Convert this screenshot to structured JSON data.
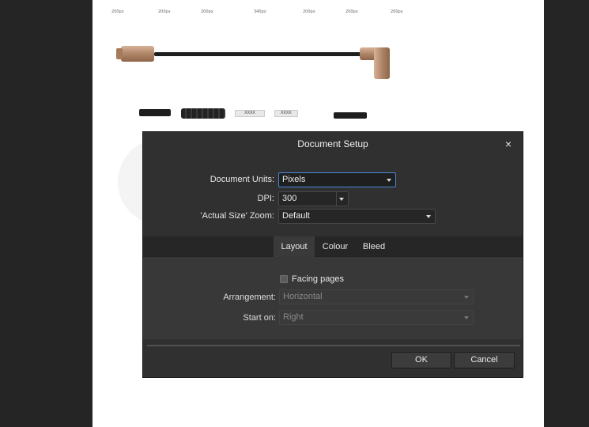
{
  "canvas": {
    "ruler_labels": [
      "200px",
      "200px",
      "200px",
      "340px",
      "200px",
      "200px",
      "200px"
    ],
    "part_labels": [
      "XXXX",
      "XXXX"
    ]
  },
  "dialog": {
    "title": "Document Setup",
    "close_icon": "×",
    "document_units": {
      "label": "Document Units:",
      "value": "Pixels"
    },
    "dpi": {
      "label": "DPI:",
      "value": "300"
    },
    "zoom": {
      "label": "'Actual Size' Zoom:",
      "value": "Default"
    },
    "tabs": [
      {
        "label": "Layout",
        "active": true
      },
      {
        "label": "Colour",
        "active": false
      },
      {
        "label": "Bleed",
        "active": false
      }
    ],
    "facing_pages": {
      "label": "Facing pages",
      "checked": false
    },
    "arrangement": {
      "label": "Arrangement:",
      "value": "Horizontal",
      "enabled": false
    },
    "start_on": {
      "label": "Start on:",
      "value": "Right",
      "enabled": false
    },
    "ok_label": "OK",
    "cancel_label": "Cancel"
  },
  "colors": {
    "background": "#252525",
    "dialog": "#303030",
    "focus_border": "#4a8ad9",
    "connector": "#b08667"
  }
}
